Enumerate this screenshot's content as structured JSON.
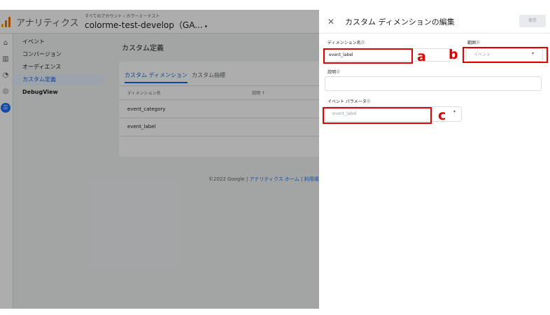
{
  "header": {
    "app_name": "アナリティクス",
    "breadcrumb": "すべてのアカウント › カラーミーテスト",
    "property_name": "colorme-test-develop（GA...",
    "property_caret": "▾",
    "logo_colors": [
      "#f9ab00",
      "#e37400",
      "#e37400"
    ]
  },
  "rail": {
    "icons": [
      {
        "name": "home-icon",
        "glyph": "⌂"
      },
      {
        "name": "reports-icon",
        "glyph": "▥"
      },
      {
        "name": "explore-icon",
        "glyph": "◔"
      },
      {
        "name": "advertising-icon",
        "glyph": "◎"
      },
      {
        "name": "configure-icon",
        "glyph": "☰"
      }
    ],
    "active_color": "#1a73e8"
  },
  "sidenav": {
    "items": [
      "イベント",
      "コンバージョン",
      "オーディエンス",
      "カスタム定義",
      "DebugView"
    ],
    "active_index": 3
  },
  "main": {
    "page_title": "カスタム定義",
    "tabs": [
      "カスタム ディメンション",
      "カスタム指標"
    ],
    "active_tab": 0,
    "columns": [
      "ディメンション名",
      "説明 ↑"
    ],
    "rows": [
      "event_category",
      "event_label"
    ],
    "footer": {
      "copyright": "©2022 Google | ",
      "home_link": "アナリティクス ホーム",
      "sep": " | ",
      "terms_link": "利用規"
    }
  },
  "panel": {
    "close_glyph": "✕",
    "title": "カスタム ディメンションの編集",
    "save_label": "保存",
    "dimension_name_label": "ディメンション名",
    "dimension_name_value": "event_label",
    "scope_label": "範囲",
    "scope_value": "イベント",
    "description_label": "説明",
    "description_value": "",
    "event_param_label": "イベント パラメータ",
    "event_param_value": "event_label",
    "help_glyph": "⓪",
    "dropdown_caret": "▾"
  },
  "annotations": {
    "a": "a",
    "b": "b",
    "c": "c",
    "color": "#e00000"
  }
}
